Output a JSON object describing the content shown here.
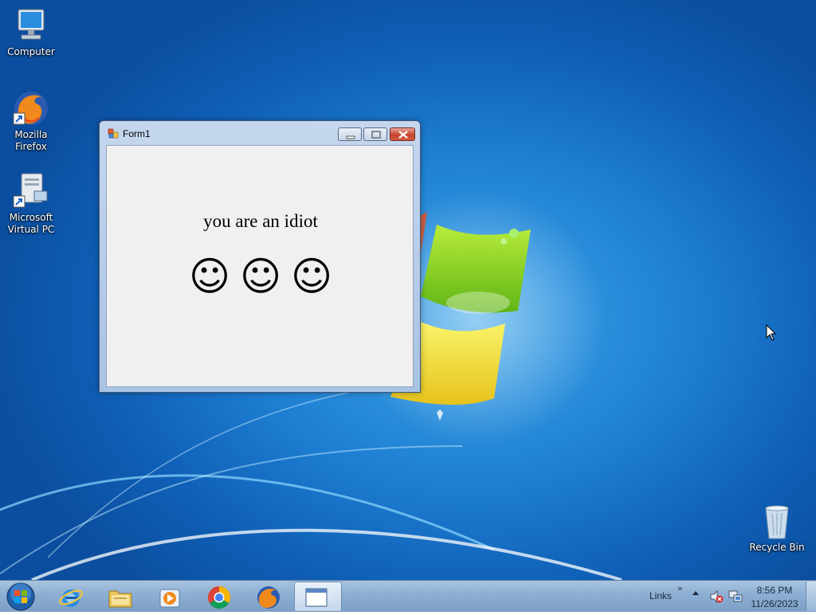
{
  "desktop": {
    "icons": [
      {
        "label": "Computer",
        "icon": "computer-icon"
      },
      {
        "label": "Mozilla Firefox",
        "icon": "firefox-icon"
      },
      {
        "label": "Microsoft Virtual PC",
        "icon": "virtual-pc-icon"
      },
      {
        "label": "Recycle Bin",
        "icon": "recycle-bin-icon"
      }
    ]
  },
  "window": {
    "title": "Form1",
    "message": "you are an idiot",
    "smileys": [
      "☺",
      "☺",
      "☺"
    ]
  },
  "taskbar": {
    "pinned": [
      "start-orb-icon",
      "internet-explorer-icon",
      "file-explorer-icon",
      "media-player-icon",
      "chrome-icon",
      "firefox-icon",
      "form-window-icon"
    ],
    "links_label": "Links",
    "links_chevron": "»",
    "clock_time": "8:56 PM",
    "clock_date": "11/26/2023"
  },
  "colors": {
    "desktop_blue": "#1e7fd2",
    "taskbar": "#8fb0d4",
    "close_red": "#c7442f"
  }
}
